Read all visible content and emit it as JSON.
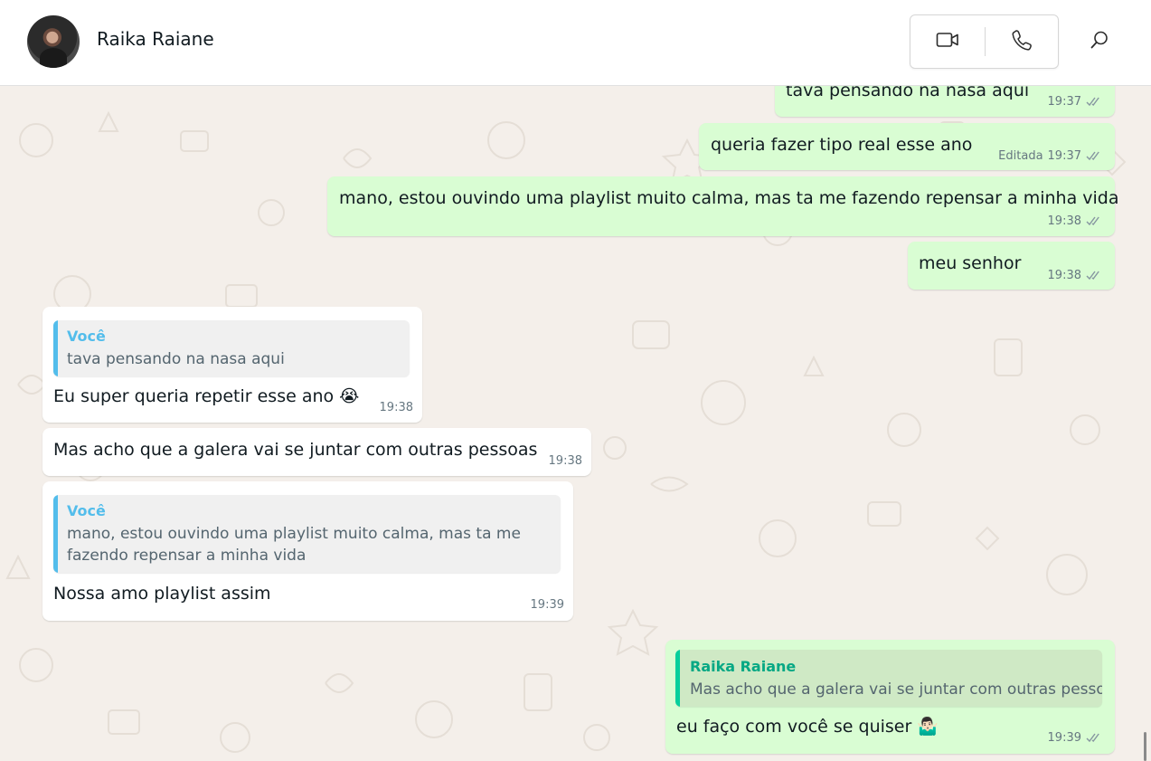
{
  "header": {
    "contact_name": "Raika Raiane",
    "icons": {
      "video": "video-camera-icon",
      "voice": "phone-icon",
      "search": "search-icon"
    }
  },
  "colors": {
    "outgoing_bubble": "#d9fdd3",
    "incoming_bubble": "#ffffff",
    "chat_background": "#f4efea",
    "quote_you_accent": "#53bdeb",
    "quote_contact_accent": "#06cf9c",
    "timestamp": "#667781"
  },
  "messages": [
    {
      "direction": "out",
      "text": "tava pensando na nasa aqui",
      "time": "19:37",
      "status": "read"
    },
    {
      "direction": "out",
      "text": "queria fazer tipo real esse ano",
      "edited_label": "Editada",
      "time": "19:37",
      "status": "read"
    },
    {
      "direction": "out",
      "text": "mano, estou ouvindo uma playlist muito calma, mas ta me fazendo repensar a minha vida",
      "time": "19:38",
      "status": "read"
    },
    {
      "direction": "out",
      "text": "meu senhor",
      "time": "19:38",
      "status": "read"
    },
    {
      "direction": "in",
      "quote": {
        "author": "Você",
        "text": "tava pensando na nasa aqui"
      },
      "text": "Eu super queria repetir esse ano 😭",
      "time": "19:38"
    },
    {
      "direction": "in",
      "text": "Mas acho que a galera vai se juntar com outras pessoas",
      "time": "19:38"
    },
    {
      "direction": "in",
      "quote": {
        "author": "Você",
        "text": "mano, estou ouvindo uma playlist muito calma, mas ta me fazendo repensar a minha vida"
      },
      "text": "Nossa amo playlist assim",
      "time": "19:39"
    },
    {
      "direction": "out",
      "quote": {
        "author": "Raika Raiane",
        "text": "Mas acho que a galera vai se juntar com outras pessoas"
      },
      "text": "eu faço com você se quiser 🤷🏻‍♂️",
      "time": "19:39",
      "status": "read"
    }
  ]
}
